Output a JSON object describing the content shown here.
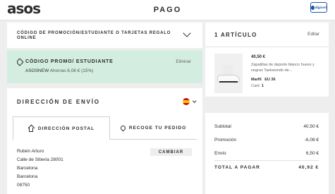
{
  "header": {
    "logo": "asos",
    "title": "PAGO",
    "badge_label": "digicert"
  },
  "promo": {
    "header_title": "CÓDIGO DE PROMOCIÓN/ESTUDIANTE O TARJETAS REGALO ONLINE",
    "applied_title": "CÓDIGO PROMO/ ESTUDIANTE",
    "applied_code": "ASOSNEW",
    "applied_saving": "Ahorras 6,08 € (15%)",
    "remove_label": "Eliminar"
  },
  "shipping": {
    "title": "DIRECCIÓN DE ENVÍO",
    "country_icon": "spain-flag-icon",
    "tabs": [
      {
        "label": "DIRECCIÓN POSTAL",
        "icon": "home-icon",
        "active": true
      },
      {
        "label": "RECOGE TU PEDIDO",
        "icon": "location-pin-icon",
        "active": false
      }
    ],
    "change_label": "CAMBIAR",
    "address_lines": [
      "Rubén Arturo",
      "Calle de Siberia 28001",
      "Barcelona",
      "Barcelona",
      "08750"
    ]
  },
  "cart": {
    "title": "1 ARTÍCULO",
    "edit_label": "Editar",
    "item": {
      "price": "40,50 €",
      "name": "Zapatillas de deporte blanco hueso y negras Taekwondo de...",
      "color": "Marfil",
      "size": "EU 36",
      "qty_label": "Cant:",
      "qty": "1"
    }
  },
  "totals": {
    "rows": [
      {
        "label": "Subtotal",
        "value": "40,50 €"
      },
      {
        "label": "Promoción",
        "value": "-6,08 €"
      },
      {
        "label": "Envío",
        "value": "6,50 €"
      }
    ],
    "total_label": "TOTAL A PAGAR",
    "total_value": "40,92 €"
  },
  "colors": {
    "promo_applied_bg": "#d3eee0",
    "page_bg": "#eeeeee",
    "text": "#2d2d2d"
  }
}
